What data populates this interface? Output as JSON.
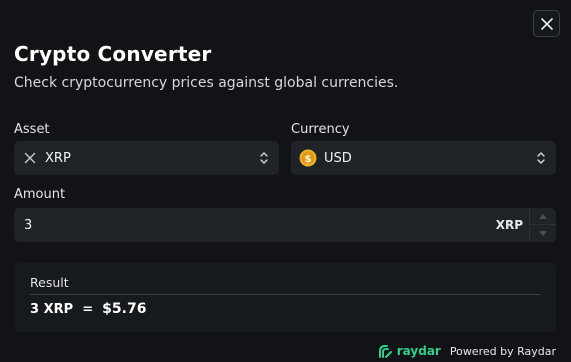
{
  "dialog": {
    "title": "Crypto Converter",
    "subtitle": "Check cryptocurrency prices against global currencies."
  },
  "asset": {
    "label": "Asset",
    "value": "XRP",
    "icon": "xrp-icon"
  },
  "currency": {
    "label": "Currency",
    "value": "USD",
    "icon": "dollar-coin-icon"
  },
  "amount": {
    "label": "Amount",
    "value": "3",
    "unit": "XRP"
  },
  "result": {
    "label": "Result",
    "from_text": "3 XRP",
    "equals": "=",
    "converted": "$5.76"
  },
  "footer": {
    "brand": "raydar",
    "powered_by": "Powered by Raydar"
  },
  "colors": {
    "background": "#111316",
    "field": "#1f2328",
    "coin": "#f0b429",
    "brand": "#2fd08a"
  }
}
